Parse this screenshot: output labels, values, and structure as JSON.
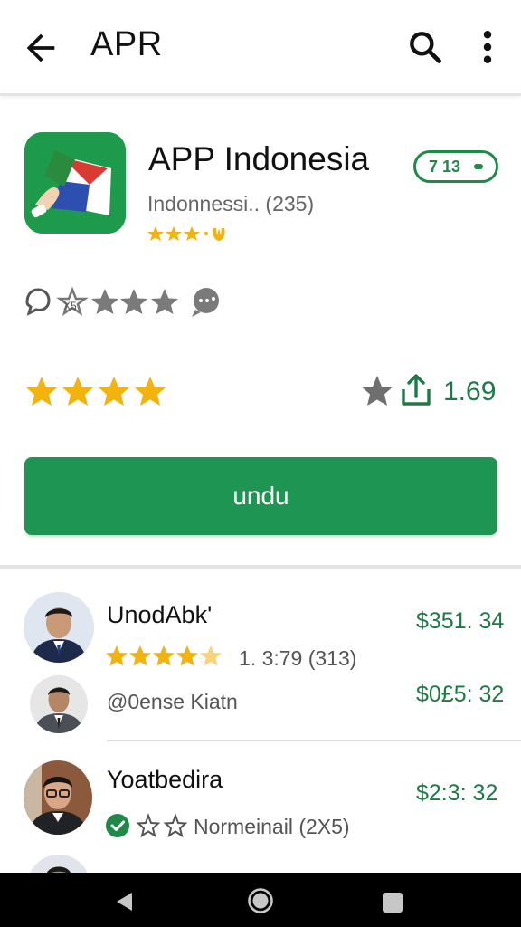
{
  "appbar": {
    "title": "APR",
    "icons": [
      "back-arrow-icon",
      "search-icon",
      "more-vert-icon"
    ]
  },
  "app": {
    "name": "APP Indonesia",
    "developer": "Indonnessi.. (235)",
    "badge": "7 13",
    "icon": "app-flag-book-icon"
  },
  "rating": {
    "stars_filled": 4,
    "value": "1.69",
    "icons": [
      "star-outline-icon",
      "share-icon"
    ]
  },
  "install": {
    "label": "undu"
  },
  "list": [
    {
      "name": "UnodAbk'",
      "price": "$351. 34",
      "rating_text": "1. 3:79 (313)",
      "stars": 4.5
    },
    {
      "name": "",
      "sub": "@0ense Kiatn",
      "price": "$0£5: 32"
    },
    {
      "name": "Yoatbedira",
      "sub": "Normeinail (2X5)",
      "price": "$2:3: 32"
    }
  ],
  "colors": {
    "accent": "#1f9553",
    "star": "#f2b30f",
    "price": "#1e7a44",
    "navbar": "#000000"
  }
}
